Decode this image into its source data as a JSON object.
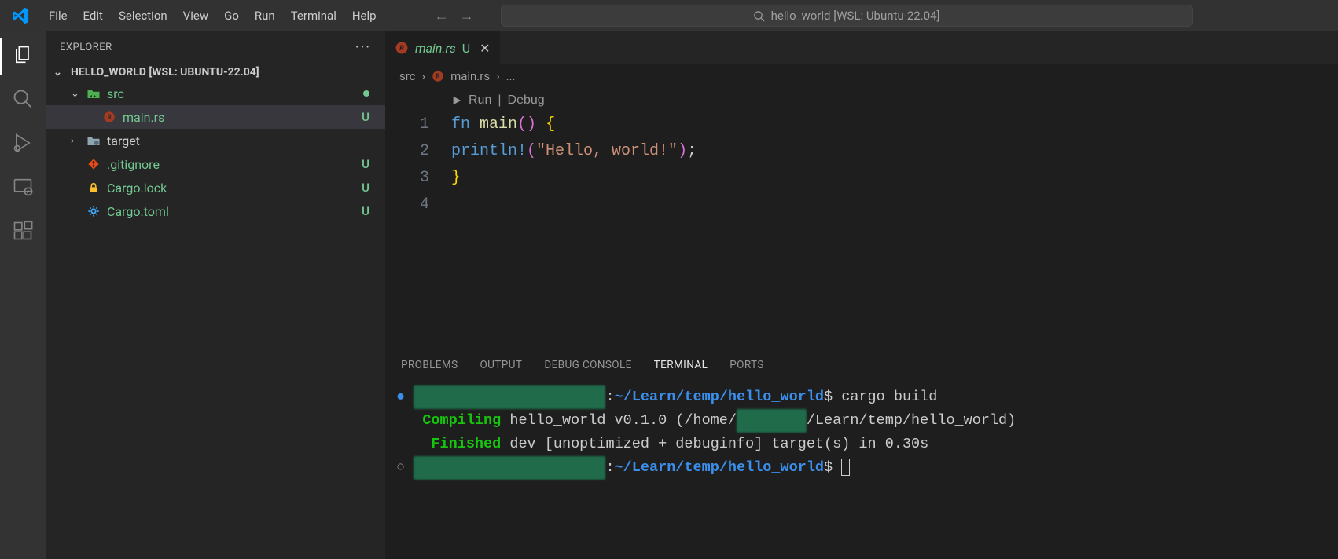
{
  "menu": [
    "File",
    "Edit",
    "Selection",
    "View",
    "Go",
    "Run",
    "Terminal",
    "Help"
  ],
  "search_title": "hello_world [WSL: Ubuntu-22.04]",
  "sidebar": {
    "title": "EXPLORER",
    "folder": "HELLO_WORLD [WSL: UBUNTU-22.04]",
    "items": [
      {
        "type": "folder",
        "label": "src",
        "status": "dot",
        "indent": 1,
        "open": true,
        "icon": "folder-src",
        "color": "#73c991"
      },
      {
        "type": "file",
        "label": "main.rs",
        "status": "U",
        "indent": 2,
        "icon": "rust",
        "color": "#73c991",
        "selected": true
      },
      {
        "type": "folder",
        "label": "target",
        "status": "",
        "indent": 1,
        "open": false,
        "icon": "folder",
        "color": "#cccccc"
      },
      {
        "type": "file",
        "label": ".gitignore",
        "status": "U",
        "indent": 1,
        "icon": "git",
        "color": "#73c991"
      },
      {
        "type": "file",
        "label": "Cargo.lock",
        "status": "U",
        "indent": 1,
        "icon": "lock",
        "color": "#73c991"
      },
      {
        "type": "file",
        "label": "Cargo.toml",
        "status": "U",
        "indent": 1,
        "icon": "gear",
        "color": "#73c991"
      }
    ]
  },
  "tab": {
    "filename": "main.rs",
    "git": "U"
  },
  "breadcrumbs": {
    "folder": "src",
    "file": "main.rs",
    "trail": "..."
  },
  "codelens": {
    "run": "Run",
    "debug": "Debug"
  },
  "code": {
    "line1": {
      "kw": "fn",
      "name": "main",
      "paren": "()",
      "brace": "{"
    },
    "line2": {
      "macro": "println!",
      "open": "(",
      "string": "\"Hello, world!\"",
      "close": ")",
      ";": ";"
    },
    "line3": {
      "brace": "}"
    }
  },
  "panel_tabs": [
    "PROBLEMS",
    "OUTPUT",
    "DEBUG CONSOLE",
    "TERMINAL",
    "PORTS"
  ],
  "panel_active": "TERMINAL",
  "terminal": {
    "prompt_user_redacted": "user@hostname-redacted",
    "prompt_path": "~/Learn/temp/hello_world",
    "cmd1": "cargo build",
    "line_compiling_label": "Compiling",
    "line_compiling_rest": " hello_world v0.1.0 (/home/",
    "line_compiling_rest2": "/Learn/temp/hello_world)",
    "line_finished_label": "Finished",
    "line_finished_rest": " dev [unoptimized + debuginfo] target(s) in 0.30s"
  }
}
